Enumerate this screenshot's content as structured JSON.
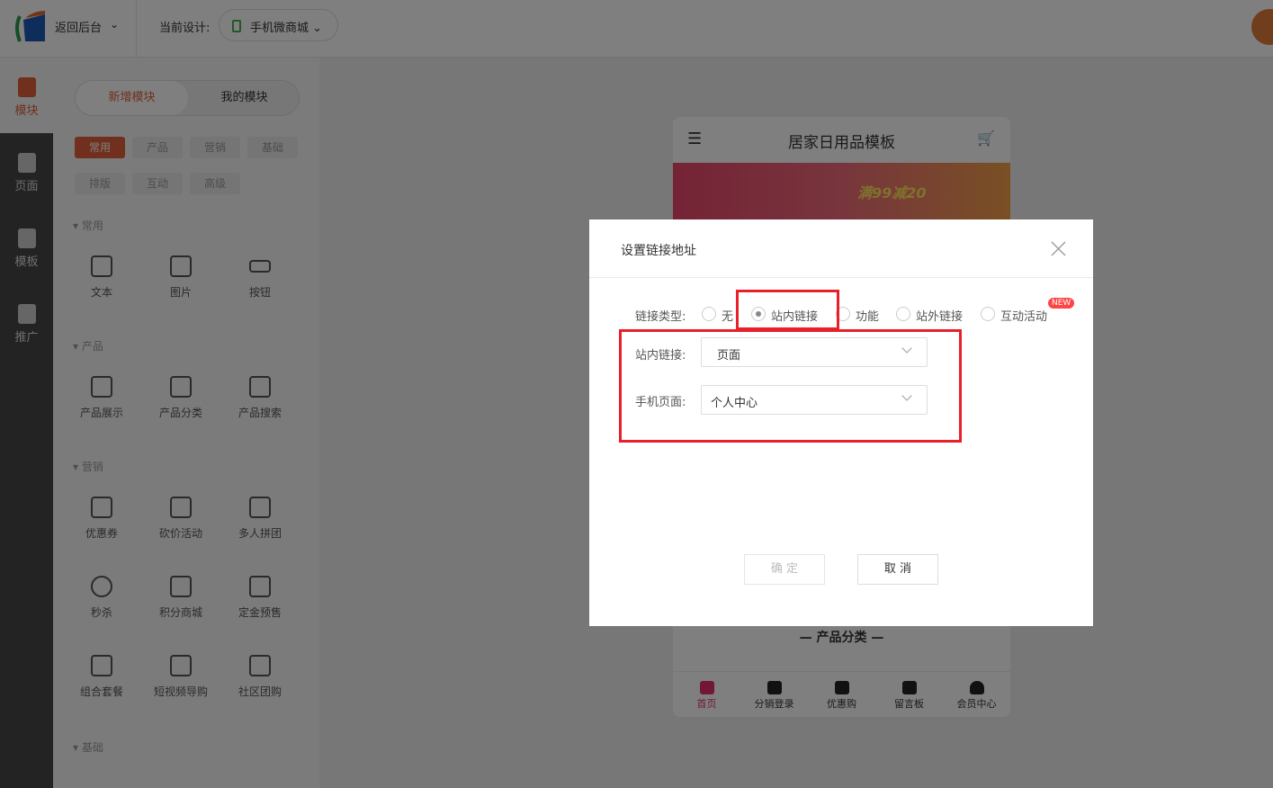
{
  "topbar": {
    "back": "返回后台",
    "current_label": "当前设计:",
    "design": "手机微商城"
  },
  "rail": [
    "模块",
    "页面",
    "模板",
    "推广"
  ],
  "panel": {
    "tabs": [
      "新增模块",
      "我的模块"
    ],
    "categories": [
      "常用",
      "产品",
      "营销",
      "基础",
      "排版",
      "互动",
      "高级"
    ],
    "sections": [
      {
        "title": "常用",
        "items": [
          "文本",
          "图片",
          "按钮"
        ]
      },
      {
        "title": "产品",
        "items": [
          "产品展示",
          "产品分类",
          "产品搜索"
        ]
      },
      {
        "title": "营销",
        "items": [
          "优惠券",
          "砍价活动",
          "多人拼团",
          "秒杀",
          "积分商城",
          "定金预售",
          "组合套餐",
          "短视频导购",
          "社区团购"
        ]
      },
      {
        "title": "基础",
        "items": []
      }
    ]
  },
  "phone": {
    "title": "居家日用品模板",
    "banner_text": "满99减20",
    "category_title": "产品分类",
    "tabs": [
      "首页",
      "分销登录",
      "优惠购",
      "留言板",
      "会员中心"
    ]
  },
  "dialog": {
    "title": "设置链接地址",
    "link_type_label": "链接类型:",
    "types": [
      "无",
      "站内链接",
      "功能",
      "站外链接",
      "互动活动"
    ],
    "new_badge": "NEW",
    "internal_label": "站内链接:",
    "internal_value": "页面",
    "page_label": "手机页面:",
    "page_value": "个人中心",
    "ok": "确 定",
    "cancel": "取 消"
  },
  "colors": {
    "accent": "#e0603a",
    "highlight": "#e8202a"
  }
}
